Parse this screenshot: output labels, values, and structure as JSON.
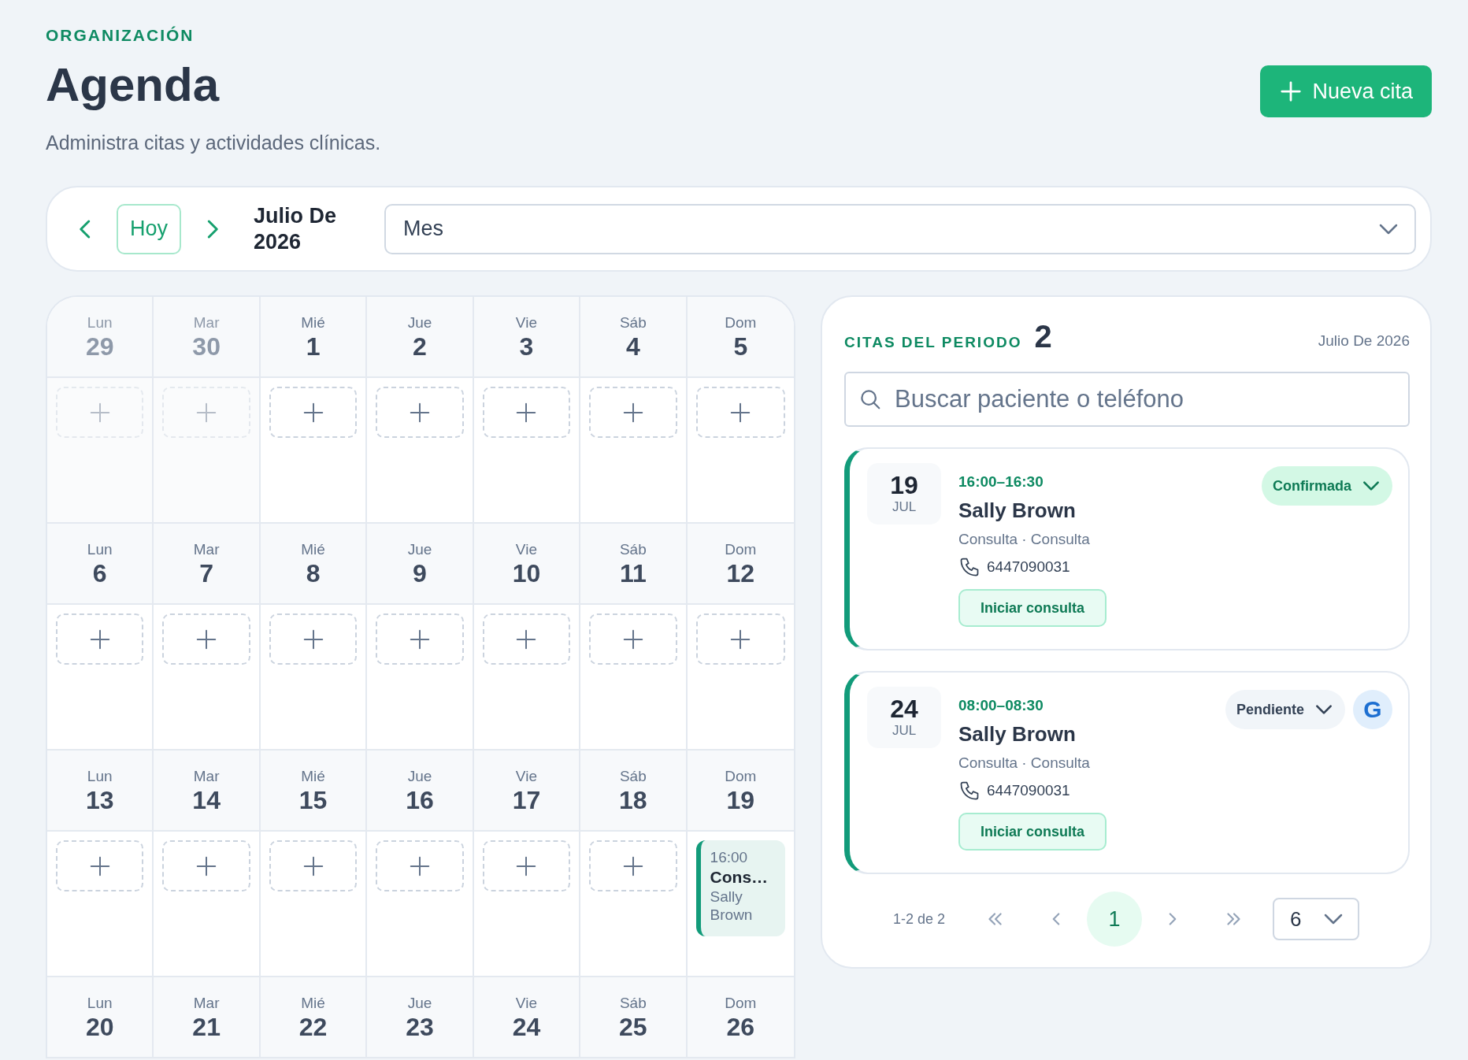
{
  "header": {
    "eyebrow": "ORGANIZACIÓN",
    "title": "Agenda",
    "subtitle": "Administra citas y actividades clínicas.",
    "new_button": "Nueva cita"
  },
  "toolbar": {
    "today": "Hoy",
    "period": "Julio De 2026",
    "view": "Mes"
  },
  "calendar": {
    "weeks": [
      {
        "days": [
          {
            "dow": "Lun",
            "day": "29",
            "outside": true
          },
          {
            "dow": "Mar",
            "day": "30",
            "outside": true
          },
          {
            "dow": "Mié",
            "day": "1",
            "outside": false
          },
          {
            "dow": "Jue",
            "day": "2",
            "outside": false
          },
          {
            "dow": "Vie",
            "day": "3",
            "outside": false
          },
          {
            "dow": "Sáb",
            "day": "4",
            "outside": false
          },
          {
            "dow": "Dom",
            "day": "5",
            "outside": false
          }
        ]
      },
      {
        "days": [
          {
            "dow": "Lun",
            "day": "6",
            "outside": false
          },
          {
            "dow": "Mar",
            "day": "7",
            "outside": false
          },
          {
            "dow": "Mié",
            "day": "8",
            "outside": false
          },
          {
            "dow": "Jue",
            "day": "9",
            "outside": false
          },
          {
            "dow": "Vie",
            "day": "10",
            "outside": false
          },
          {
            "dow": "Sáb",
            "day": "11",
            "outside": false
          },
          {
            "dow": "Dom",
            "day": "12",
            "outside": false
          }
        ]
      },
      {
        "days": [
          {
            "dow": "Lun",
            "day": "13",
            "outside": false
          },
          {
            "dow": "Mar",
            "day": "14",
            "outside": false
          },
          {
            "dow": "Mié",
            "day": "15",
            "outside": false
          },
          {
            "dow": "Jue",
            "day": "16",
            "outside": false
          },
          {
            "dow": "Vie",
            "day": "17",
            "outside": false
          },
          {
            "dow": "Sáb",
            "day": "18",
            "outside": false
          },
          {
            "dow": "Dom",
            "day": "19",
            "outside": false,
            "events": [
              {
                "time": "16:00",
                "title": "Cons…",
                "patient": "Sally Brown"
              }
            ]
          }
        ]
      },
      {
        "days": [
          {
            "dow": "Lun",
            "day": "20",
            "outside": false
          },
          {
            "dow": "Mar",
            "day": "21",
            "outside": false
          },
          {
            "dow": "Mié",
            "day": "22",
            "outside": false
          },
          {
            "dow": "Jue",
            "day": "23",
            "outside": false
          },
          {
            "dow": "Vie",
            "day": "24",
            "outside": false
          },
          {
            "dow": "Sáb",
            "day": "25",
            "outside": false
          },
          {
            "dow": "Dom",
            "day": "26",
            "outside": false
          }
        ]
      }
    ]
  },
  "panel": {
    "title": "CITAS DEL PERIODO",
    "count": "2",
    "period": "Julio De 2026",
    "search": {
      "placeholder": "Buscar paciente o teléfono"
    },
    "appointments": [
      {
        "day": "19",
        "month": "JUL",
        "time": "16:00–16:30",
        "patient": "Sally Brown",
        "detail": "Consulta · Consulta",
        "phone": "6447090031",
        "status": {
          "label": "Confirmada",
          "kind": "confirmed"
        },
        "action": "Iniciar consulta"
      },
      {
        "day": "24",
        "month": "JUL",
        "time": "08:00–08:30",
        "patient": "Sally Brown",
        "detail": "Consulta · Consulta",
        "phone": "6447090031",
        "status": {
          "label": "Pendiente",
          "kind": "pending"
        },
        "badge": "G",
        "action": "Iniciar consulta"
      }
    ],
    "pagination": {
      "range": "1-2 de 2",
      "pages": [
        {
          "label": "1",
          "selected": true
        }
      ],
      "page_size": "6"
    }
  }
}
